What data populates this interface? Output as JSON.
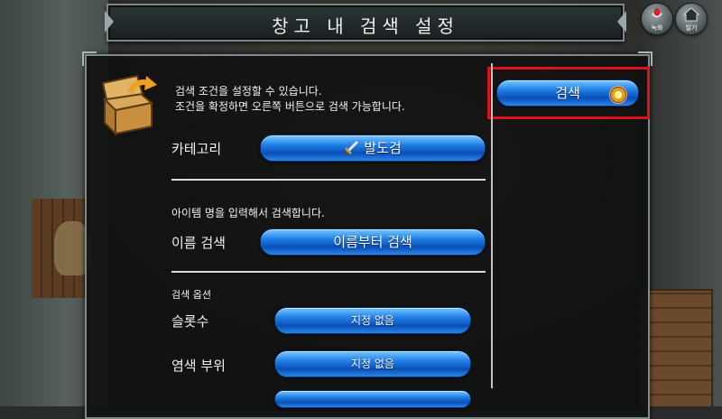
{
  "title": "창고 내 검색 설정",
  "top_icons": [
    {
      "name": "record",
      "label": "녹화"
    },
    {
      "name": "home",
      "label": "일기"
    }
  ],
  "description": {
    "line1": "검색 조건을 설정할 수 있습니다.",
    "line2": "조건을 확정하면 오른쪽 버튼으로 검색 가능합니다."
  },
  "search_button": {
    "label": "검색"
  },
  "category": {
    "label": "카테고리",
    "value": "발도검",
    "icon": "sword-icon"
  },
  "name_section": {
    "hint": "아이템 명을 입력해서 검색합니다.",
    "label": "이름 검색",
    "button": "이름부터 검색"
  },
  "options": {
    "heading": "검색 옵션",
    "rows": [
      {
        "label": "슬롯수",
        "value": "지정 없음"
      },
      {
        "label": "염색 부위",
        "value": "지정 없음"
      }
    ]
  },
  "colors": {
    "accent_blue": "#1f7fe6",
    "highlight_red": "#e0101a"
  }
}
